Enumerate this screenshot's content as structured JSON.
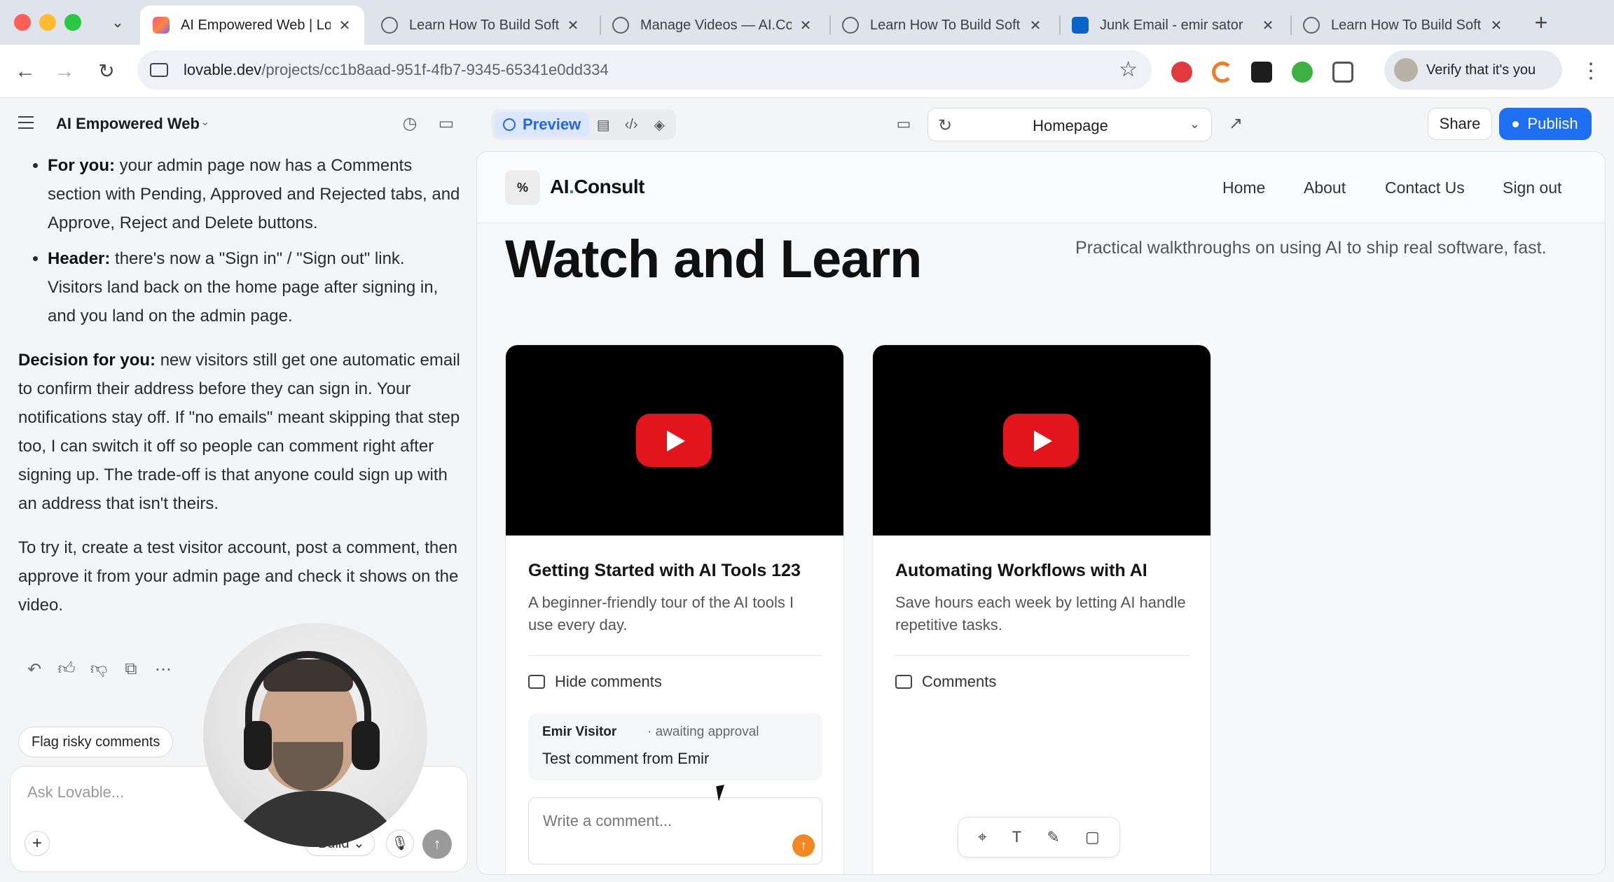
{
  "browser": {
    "tabs": [
      {
        "title": "AI Empowered Web | Lo",
        "icon": "lovable-icon"
      },
      {
        "title": "Learn How To Build Soft",
        "icon": "globe-icon"
      },
      {
        "title": "Manage Videos — AI.Co",
        "icon": "globe-icon"
      },
      {
        "title": "Learn How To Build Soft",
        "icon": "globe-icon"
      },
      {
        "title": "Junk Email - emir sator",
        "icon": "outlook-icon"
      },
      {
        "title": "Learn How To Build Soft",
        "icon": "globe-icon"
      }
    ],
    "url_domain": "lovable.dev",
    "url_path": "/projects/cc1b8aad-951f-4fb7-9345-65341e0dd334",
    "profile_label": "Verify that it's you"
  },
  "lovable": {
    "project_name": "AI Empowered Web",
    "preview_tab_label": "Preview",
    "route": "Homepage",
    "share_label": "Share",
    "publish_label": "Publish",
    "accent_color": "#1f6ff2"
  },
  "chat": {
    "bullets": [
      {
        "lead": "For you:",
        "text": " your admin page now has a Comments section with Pending, Approved and Rejected tabs, and Approve, Reject and Delete buttons."
      },
      {
        "lead": "Header:",
        "text": " there's now a \"Sign in\" / \"Sign out\" link. Visitors land back on the home page after signing in, and you land on the admin page."
      }
    ],
    "decision_lead": "Decision for you:",
    "decision_text": " new visitors still get one automatic email to confirm their address before they can sign in. Your notifications stay off. If \"no emails\" meant skipping that step too, I can switch it off so people can comment right after signing up. The trade-off is that anyone could sign up with an address that isn't theirs.",
    "try_text": "To try it, create a test visitor account, post a comment, then approve it from your admin page and check it shows on the video.",
    "suggestion": "Flag risky comments",
    "composer_placeholder": "Ask Lovable...",
    "mode_label": "Build"
  },
  "site": {
    "brand_main": "AI",
    "brand_dot": ".",
    "brand_rest": "Consult",
    "nav": [
      "Home",
      "About",
      "Contact Us",
      "Sign out"
    ],
    "hero_title": "Watch and Learn",
    "hero_subtitle": "Practical walkthroughs on using AI to ship real software, fast.",
    "videos": [
      {
        "title": "Getting Started with AI Tools 123",
        "description": "A beginner-friendly tour of the AI tools I use every day.",
        "comments_toggle": "Hide comments",
        "comment": {
          "author": "Emir Visitor",
          "status": "· awaiting approval",
          "text": "Test comment from Emir"
        },
        "comment_placeholder": "Write a comment..."
      },
      {
        "title": "Automating Workflows with AI",
        "description": "Save hours each week by letting AI handle repetitive tasks.",
        "comments_toggle": "Comments"
      }
    ]
  }
}
